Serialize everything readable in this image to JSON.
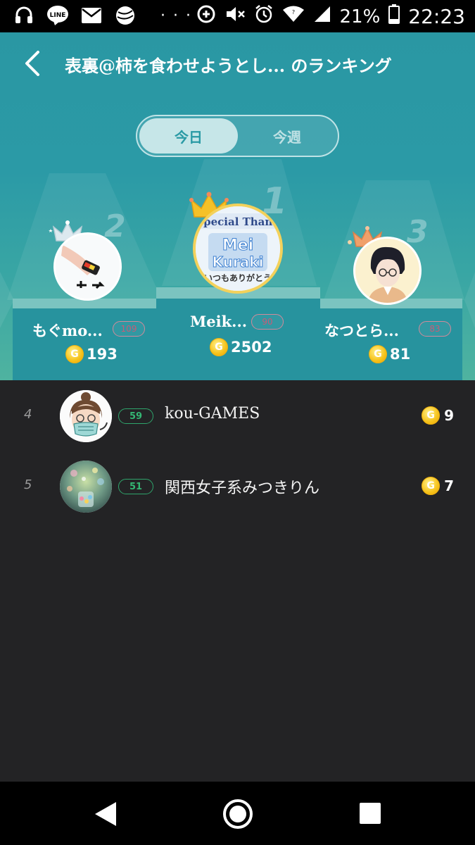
{
  "status_bar": {
    "icons_left": [
      "headset-icon",
      "line-app-icon",
      "mail-icon",
      "ball-app-icon"
    ],
    "more": "· · ·",
    "icons_right": [
      "data-saver-icon",
      "mute-icon",
      "alarm-icon",
      "wifi-icon",
      "signal-icon"
    ],
    "battery_percent": "21%",
    "time": "22:23"
  },
  "header": {
    "title": "表裏@柿を食わせようとし... のランキング",
    "tabs": [
      {
        "label": "今日",
        "active": true
      },
      {
        "label": "今週",
        "active": false
      }
    ]
  },
  "podium": [
    {
      "rank": "2",
      "name": "もぐmo...",
      "level": "109",
      "coins": "193"
    },
    {
      "rank": "1",
      "name": "Meik...",
      "level": "90",
      "coins": "2502"
    },
    {
      "rank": "3",
      "name": "なつとら...",
      "level": "83",
      "coins": "81"
    }
  ],
  "coin_symbol": "G",
  "ranking": [
    {
      "rank": "4",
      "level": "59",
      "name": "kou-GAMES",
      "coins": "9"
    },
    {
      "rank": "5",
      "level": "51",
      "name": "関西女子系みつきりん",
      "coins": "7"
    }
  ],
  "avatar_1_text": {
    "line1": "Special Thank",
    "line2": "Mei",
    "line3": "Kuraki",
    "line4": "いつもありがとう"
  },
  "colors": {
    "header_bg": "#2a97a3",
    "list_bg": "#232325",
    "accent": "#2a9aa5",
    "level_pink": "#c65c78",
    "level_green": "#34b673",
    "coin_gold": "#f6c21a"
  }
}
